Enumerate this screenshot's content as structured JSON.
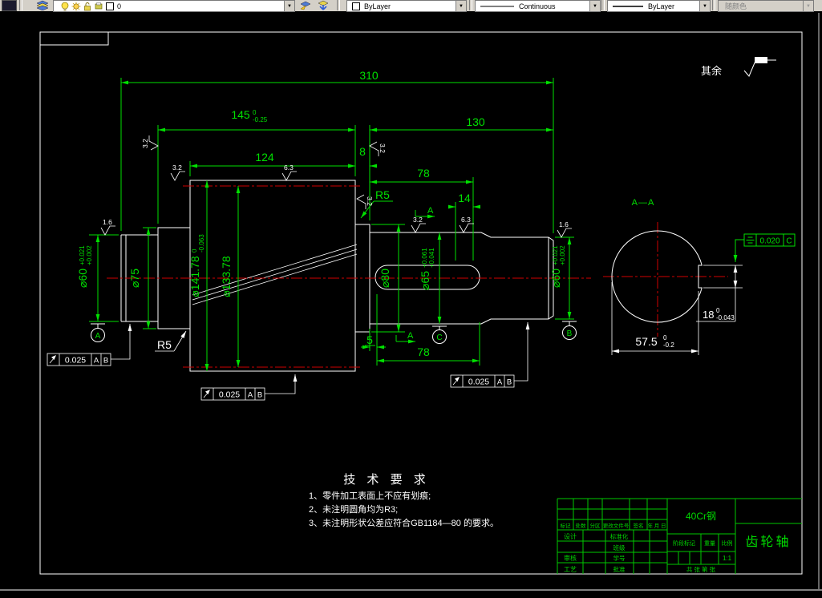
{
  "toolbar": {
    "layer": {
      "name": "0"
    },
    "color": {
      "value": "ByLayer"
    },
    "linetype": {
      "value": "Continuous"
    },
    "lineweight": {
      "value": "ByLayer"
    },
    "plot_style": {
      "value": "随颜色"
    }
  },
  "drawing": {
    "surface_note": "其余",
    "section_label": "A—A",
    "cut_label": "A",
    "dims": {
      "len_310": "310",
      "len_145": {
        "v": "145",
        "up": "0",
        "lo": "-0.25"
      },
      "len_124": "124",
      "len_8": "8",
      "len_130": "130",
      "len_78_top": "78",
      "len_14": "14",
      "len_5": "5",
      "len_78_bottom": "78",
      "dia_60_left": {
        "v": "⌀60",
        "up": "+0.021",
        "lo": "+0.002"
      },
      "dia_75": "⌀75",
      "dia_141": {
        "v": "⌀141.78",
        "up": "0",
        "lo": "-0.063"
      },
      "dia_133": "⌀133.78",
      "dia_80": "⌀80",
      "dia_65": {
        "v": "⌀65",
        "up": "+0.061",
        "lo": "+0.041"
      },
      "dia_60_right": {
        "v": "⌀60",
        "up": "+0.021",
        "lo": "+0.002"
      },
      "radius_left": "R5",
      "radius_right": "R5",
      "sec_width": {
        "v": "57.5",
        "up": "0",
        "lo": "-0.2"
      },
      "sec_key": {
        "v": "18",
        "up": "0",
        "lo": "-0.043"
      }
    },
    "roughness": {
      "r1": "1.6",
      "r2": "3.2",
      "r3": "3.2",
      "r4": "6.3",
      "r5": "3.2",
      "r6": "3.2",
      "r7": "6.3",
      "r8": "1.6",
      "r9": "3.2"
    },
    "datums": {
      "a": "A",
      "b": "B",
      "c": "C"
    },
    "frames": {
      "runout1": {
        "symbol": "circular-runout",
        "value": "0.025",
        "d1": "A",
        "d2": "B"
      },
      "runout2": {
        "symbol": "circular-runout",
        "value": "0.025",
        "d1": "A",
        "d2": "B"
      },
      "runout3": {
        "symbol": "circular-runout",
        "value": "0.025",
        "d1": "A",
        "d2": "B"
      },
      "symmetry": {
        "symbol": "symmetry",
        "value": "0.020",
        "d1": "C"
      }
    },
    "tech": {
      "title": "技 术 要 求",
      "items": [
        "1、零件加工表面上不应有划痕;",
        "2、未注明圆角均为R3;",
        "3、未注明形状公差应符合GB1184—80 的要求。"
      ]
    },
    "titleblock": {
      "material": "40Cr钢",
      "part_name": "齿轮轴",
      "rev_headers": [
        "标记",
        "处数",
        "分区",
        "更改文件号",
        "签名",
        "年 月 日"
      ],
      "left_labels": [
        "设计",
        "审核",
        "工艺"
      ],
      "mid_labels": [
        "标准化",
        "班级",
        "学号",
        "批准"
      ],
      "stage_label": "阶段标记",
      "weight_label": "重量",
      "scale_label": "比例",
      "scale_value": "1:1",
      "sheet_label": "共  张  第  张"
    }
  }
}
